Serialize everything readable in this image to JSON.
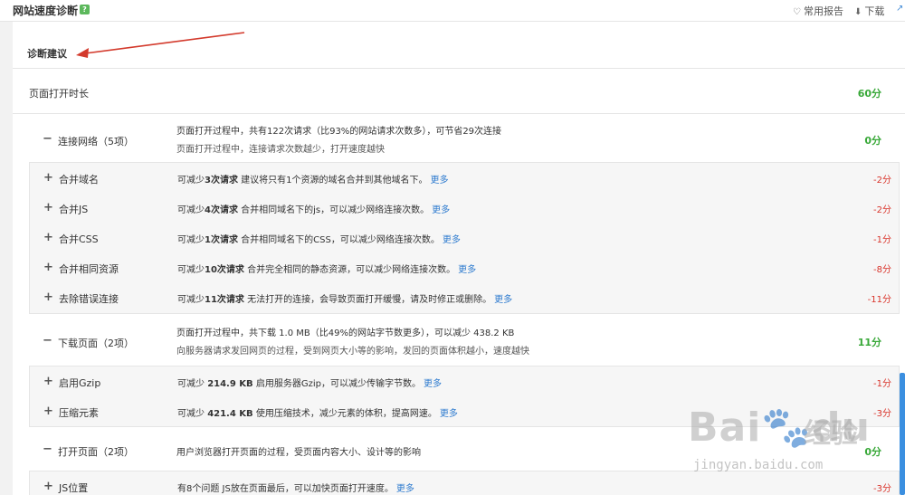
{
  "topbar": {
    "title": "网站速度诊断",
    "help_icon": "?",
    "favorites_label": "常用报告",
    "download_label": "下载"
  },
  "advice": {
    "title": "诊断建议"
  },
  "open_time": {
    "label": "页面打开时长",
    "score": "60分"
  },
  "categories": [
    {
      "sign": "−",
      "name": "连接网络（5项）",
      "desc1": "页面打开过程中，共有122次请求（比93%的网站请求次数多），可节省29次连接",
      "desc2": "页面打开过程中，连接请求次数越少，打开速度越快",
      "score": "0分",
      "items": [
        {
          "name": "合并域名",
          "pre": "可减少",
          "bold": "3次请求",
          "desc": " 建议将只有1个资源的域名合并到其他域名下。",
          "more": "更多",
          "score": "-2分"
        },
        {
          "name": "合并JS",
          "pre": "可减少",
          "bold": "4次请求",
          "desc": " 合并相同域名下的js，可以减少网络连接次数。",
          "more": "更多",
          "score": "-2分"
        },
        {
          "name": "合并CSS",
          "pre": "可减少",
          "bold": "1次请求",
          "desc": " 合并相同域名下的CSS，可以减少网络连接次数。",
          "more": "更多",
          "score": "-1分"
        },
        {
          "name": "合并相同资源",
          "pre": "可减少",
          "bold": "10次请求",
          "desc": " 合并完全相同的静态资源，可以减少网络连接次数。",
          "more": "更多",
          "score": "-8分"
        },
        {
          "name": "去除错误连接",
          "pre": "可减少",
          "bold": "11次请求",
          "desc": " 无法打开的连接，会导致页面打开缓慢，请及时修正或删除。",
          "more": "更多",
          "score": "-11分"
        }
      ]
    },
    {
      "sign": "−",
      "name": "下载页面（2项）",
      "desc1": "页面打开过程中，共下载 1.0 MB（比49%的网站字节数更多），可以减少 438.2 KB",
      "desc2": "向服务器请求发回网页的过程，受到网页大小等的影响，发回的页面体积越小，速度越快",
      "score": "11分",
      "items": [
        {
          "name": "启用Gzip",
          "pre": "可减少 ",
          "bold": "214.9 KB",
          "desc": " 启用服务器Gzip，可以减少传输字节数。",
          "more": "更多",
          "score": "-1分"
        },
        {
          "name": "压缩元素",
          "pre": "可减少 ",
          "bold": "421.4 KB",
          "desc": " 使用压缩技术，减少元素的体积，提高网速。",
          "more": "更多",
          "score": "-3分"
        }
      ]
    },
    {
      "sign": "−",
      "name": "打开页面（2项）",
      "desc1": "用户浏览器打开页面的过程，受页面内容大小、设计等的影响",
      "desc2": "",
      "score": "0分",
      "items": [
        {
          "name": "JS位置",
          "pre": "有8个问题",
          "bold": "",
          "desc": " JS放在页面最后，可以加快页面打开速度。",
          "more": "更多",
          "score": "-3分"
        }
      ]
    }
  ],
  "watermark": {
    "brand": "Bai",
    "brand2": "du",
    "cn": "经验",
    "url": "jingyan.baidu.com"
  },
  "colors": {
    "score_green": "#38a838",
    "score_red": "#d9342b",
    "link_blue": "#2e7bcf",
    "annotation_red": "#d33a2c"
  }
}
